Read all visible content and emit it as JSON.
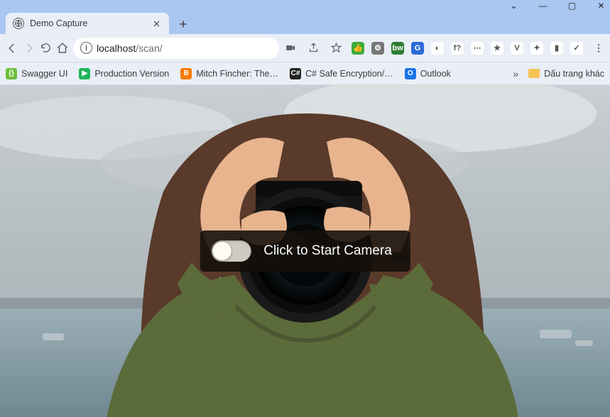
{
  "window": {
    "controls": {
      "chevron": "⌄",
      "minimize": "—",
      "maximize": "▢",
      "close": "✕"
    }
  },
  "tab": {
    "title": "Demo Capture"
  },
  "address": {
    "host": "localhost",
    "path": "/scan/"
  },
  "extensions": [
    {
      "name": "green-thumb",
      "bg": "#3eac3e",
      "glyph": "👍"
    },
    {
      "name": "gear",
      "bg": "#777",
      "glyph": "⚙"
    },
    {
      "name": "bw",
      "bg": "#2e7d32",
      "glyph": "bw"
    },
    {
      "name": "translate",
      "bg": "#2d6bd8",
      "glyph": "G"
    },
    {
      "name": "similarweb",
      "bg": "#fff",
      "glyph": "◐"
    },
    {
      "name": "wappalyzer",
      "bg": "#fff",
      "glyph": "f?"
    },
    {
      "name": "dots",
      "bg": "#fff",
      "glyph": "⋯"
    },
    {
      "name": "star-orange",
      "bg": "#fff",
      "glyph": "★"
    },
    {
      "name": "vue",
      "bg": "#fff",
      "glyph": "V"
    },
    {
      "name": "puzzle",
      "bg": "#fff",
      "glyph": "✦"
    },
    {
      "name": "panel",
      "bg": "#fff",
      "glyph": "▮"
    },
    {
      "name": "avast",
      "bg": "#fff",
      "glyph": "✓"
    }
  ],
  "bookmarks": [
    {
      "name": "swagger",
      "label": "Swagger UI",
      "bg": "#6bbf3b",
      "glyph": "{}"
    },
    {
      "name": "prod",
      "label": "Production Version",
      "bg": "#1eb559",
      "glyph": "▶"
    },
    {
      "name": "mitch",
      "label": "Mitch Fincher: The…",
      "bg": "#f57c00",
      "glyph": "B"
    },
    {
      "name": "csharp",
      "label": "C# Safe Encryption/…",
      "bg": "#222",
      "glyph": "C#"
    },
    {
      "name": "outlook",
      "label": "Outlook",
      "bg": "#1a73e8",
      "glyph": "O"
    }
  ],
  "bookmarks_overflow_glyph": "»",
  "other_bookmarks_label": "Dấu trang khác",
  "page": {
    "toggle_label": "Click to Start Camera",
    "toggle_on": false
  }
}
